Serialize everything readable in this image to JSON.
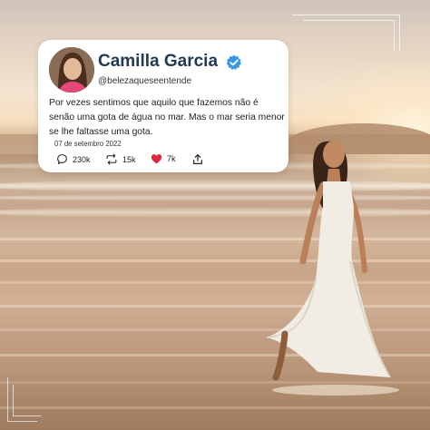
{
  "post": {
    "author_name": "Camilla Garcia",
    "handle": "@belezaqueseentende",
    "text": "Por vezes sentimos que aquilo que fazemos não é senão uma gota de água no mar. Mas o mar seria menor se lhe faltasse uma gota.",
    "date": "07 de setembro 2022",
    "verified": true,
    "stats": {
      "comments": "230k",
      "reposts": "15k",
      "likes": "7k"
    }
  },
  "icons": {
    "verified": "verified-badge-icon",
    "comment": "comment-icon",
    "repost": "repost-icon",
    "like": "heart-icon",
    "share": "share-icon"
  },
  "colors": {
    "name": "#1f3a52",
    "verified": "#3a97e8",
    "like": "#e0263b",
    "card": "#ffffff"
  }
}
